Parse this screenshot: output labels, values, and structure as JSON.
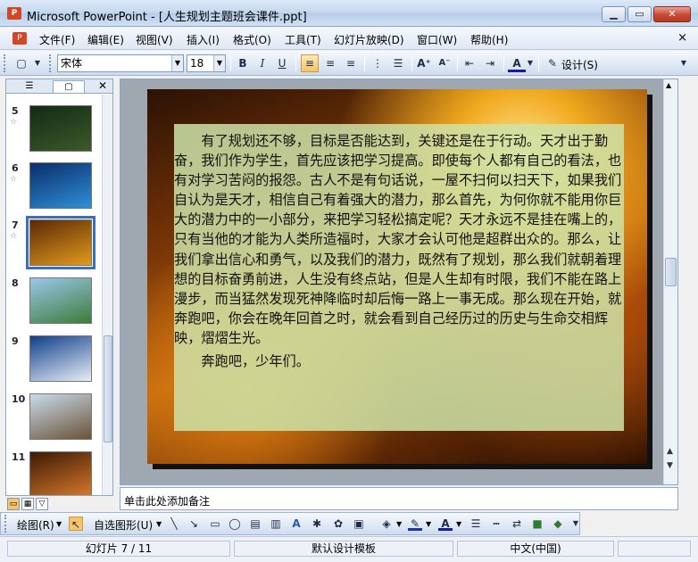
{
  "window": {
    "app_icon": "powerpoint-icon",
    "title": "Microsoft PowerPoint - [人生规划主题班会课件.ppt]",
    "buttons": [
      "minimize-icon",
      "maximize-icon",
      "close-icon"
    ]
  },
  "menu": {
    "items": [
      "文件(F)",
      "编辑(E)",
      "视图(V)",
      "插入(I)",
      "格式(O)",
      "工具(T)",
      "幻灯片放映(D)",
      "窗口(W)",
      "帮助(H)"
    ],
    "close_glyph": "×"
  },
  "toolbar": {
    "font_name": "宋体",
    "font_size": "18",
    "bold": "B",
    "italic": "I",
    "underline": "U",
    "design_label": "设计(S)"
  },
  "slides_pane": {
    "tabs": [
      "outline-tab",
      "slides-tab"
    ],
    "thumbnails": [
      {
        "num": "5",
        "colors": [
          "#142a14",
          "#3b5a2a"
        ],
        "selected": false
      },
      {
        "num": "6",
        "colors": [
          "#0a2e6a",
          "#2f8fd8"
        ],
        "selected": false
      },
      {
        "num": "7",
        "colors": [
          "#5a2a06",
          "#e39a1c"
        ],
        "selected": true
      },
      {
        "num": "8",
        "colors": [
          "#9bc6e8",
          "#3c7d3a"
        ],
        "selected": false
      },
      {
        "num": "9",
        "colors": [
          "#0f3f8a",
          "#e8eef6"
        ],
        "selected": false
      },
      {
        "num": "10",
        "colors": [
          "#c8dbe9",
          "#6c5238"
        ],
        "selected": false
      },
      {
        "num": "11",
        "colors": [
          "#3b1a06",
          "#d9792a"
        ],
        "selected": false
      }
    ]
  },
  "slide": {
    "paragraph": "有了规划还不够，目标是否能达到，关键还是在于行动。天才出于勤奋，我们作为学生，首先应该把学习提高。即使每个人都有自己的看法，也有对学习苦闷的报怨。古人不是有句话说，一屋不扫何以扫天下，如果我们自认为是天才，相信自己有着强大的潜力，那么首先，为何你就不能用你巨大的潜力中的一小部分，来把学习轻松搞定呢？天才永远不是挂在嘴上的，只有当他的才能为人类所造福时，大家才会认可他是超群出众的。那么，让我们拿出信心和勇气，以及我们的潜力，既然有了规划，那么我们就朝着理想的目标奋勇前进，人生没有终点站，但是人生却有时限，我们不能在路上漫步，而当猛然发现死神降临时却后悔一路上一事无成。那么现在开始，就奔跑吧，你会在晚年回首之时，就会看到自己经历过的历史与生命交相辉映，熠熠生光。",
    "closing": "奔跑吧，少年们。"
  },
  "notes": {
    "placeholder": "单击此处添加备注"
  },
  "drawing_toolbar": {
    "draw_label": "绘图(R)",
    "autoshapes_label": "自选图形(U)"
  },
  "status": {
    "slide_info": "幻灯片 7 / 11",
    "template": "默认设计模板",
    "language": "中文(中国)"
  }
}
